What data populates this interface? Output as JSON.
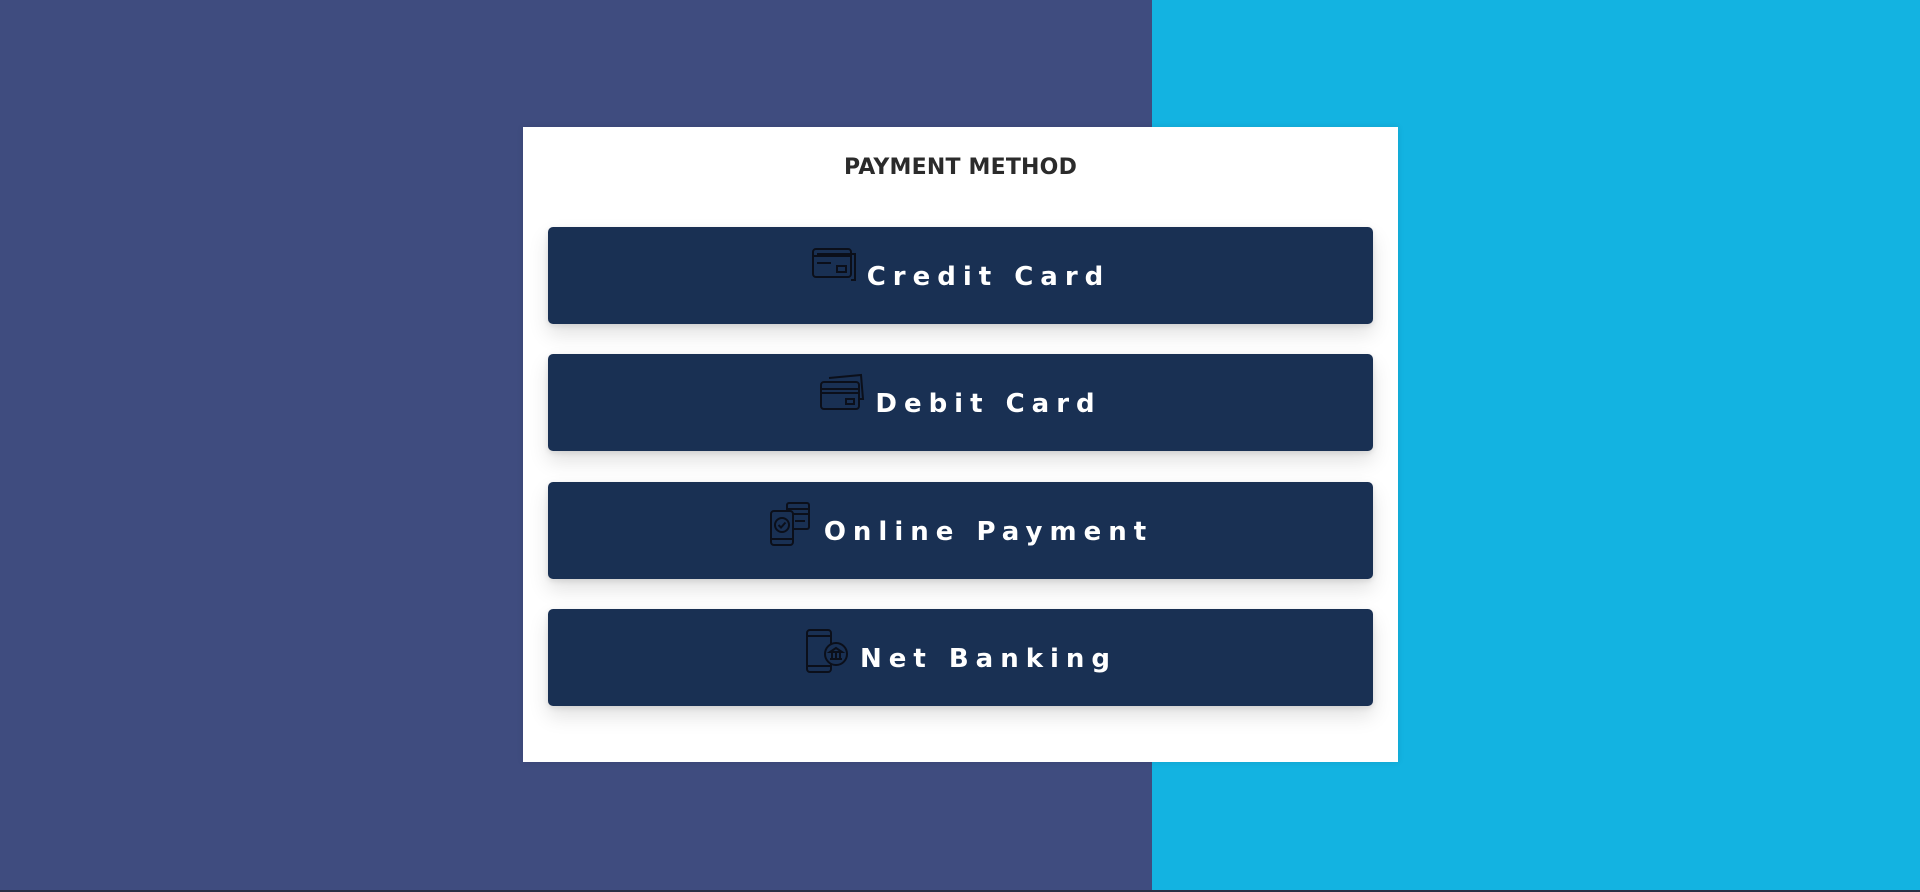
{
  "colors": {
    "bg_left": "#3f4c7f",
    "bg_right": "#13b3e1",
    "panel": "#ffffff",
    "button": "#193053",
    "button_text": "#ffffff",
    "icon_stroke": "#0b0f1a"
  },
  "panel": {
    "title": "PAYMENT METHOD"
  },
  "methods": [
    {
      "label": "Credit Card",
      "icon": "credit-card-icon"
    },
    {
      "label": "Debit Card",
      "icon": "debit-card-icon"
    },
    {
      "label": "Online Payment",
      "icon": "online-payment-icon"
    },
    {
      "label": "Net Banking",
      "icon": "net-banking-icon"
    }
  ]
}
